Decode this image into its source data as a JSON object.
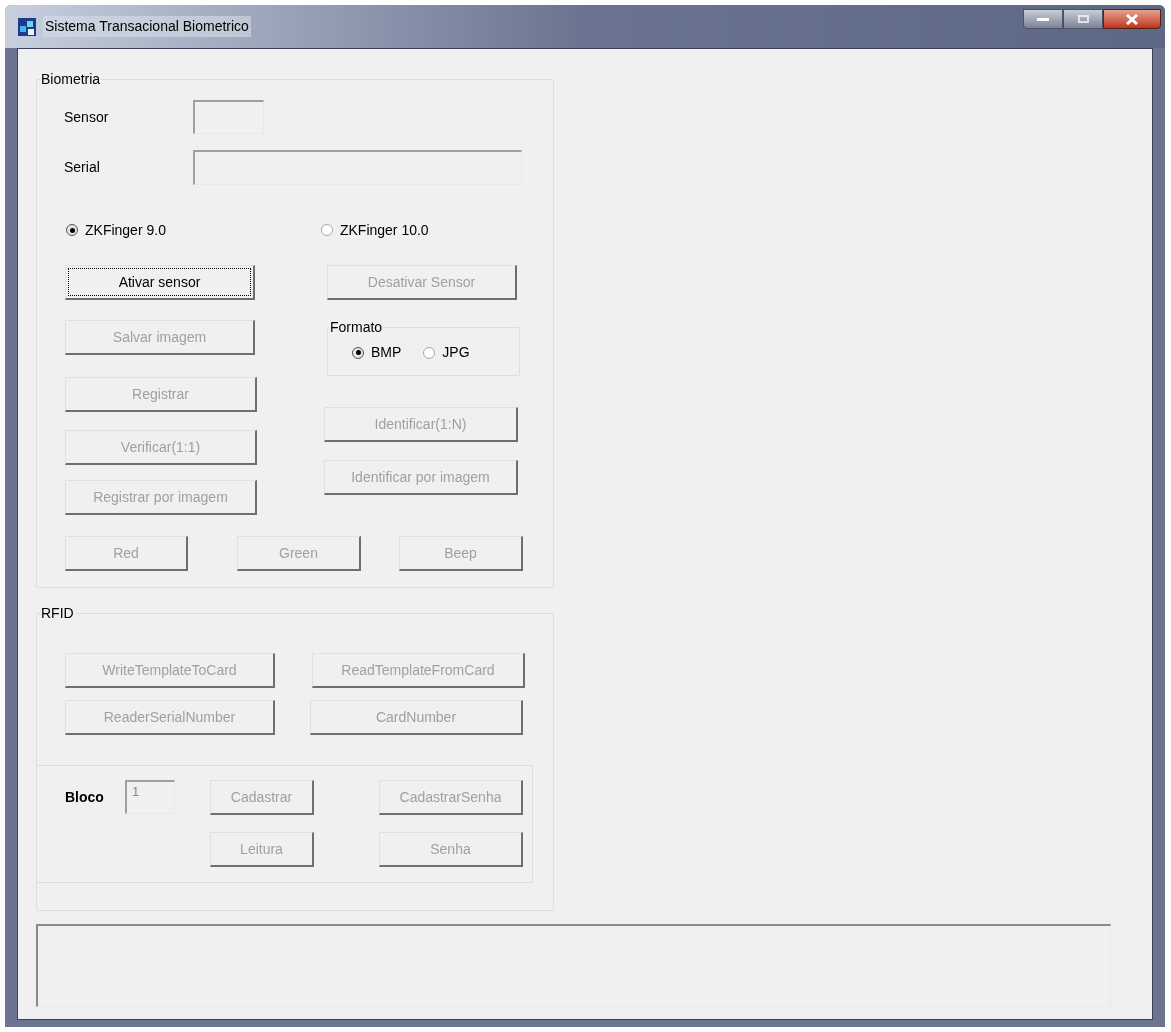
{
  "window": {
    "title": "Sistema Transacional Biometrico"
  },
  "biometria": {
    "title": "Biometria",
    "sensor": {
      "label": "Sensor"
    },
    "serial": {
      "label": "Serial"
    },
    "sdk_options": [
      {
        "label": "ZKFinger 9.0",
        "selected": true
      },
      {
        "label": "ZKFinger 10.0",
        "selected": false
      }
    ],
    "left_buttons": [
      {
        "label": "Ativar sensor",
        "disabled": false,
        "focused": true
      },
      {
        "label": "Salvar imagem",
        "disabled": true,
        "focused": false
      },
      {
        "label": "Registrar",
        "disabled": true,
        "focused": false
      },
      {
        "label": "Verificar(1:1)",
        "disabled": true,
        "focused": false
      },
      {
        "label": "Registrar por imagem",
        "disabled": true,
        "focused": false
      }
    ],
    "deactivate_button": {
      "label": "Desativar Sensor",
      "disabled": true,
      "focused": false
    },
    "formato": {
      "title": "Formato",
      "options": [
        {
          "label": "BMP",
          "selected": true
        },
        {
          "label": "JPG",
          "selected": false
        }
      ]
    },
    "identify_buttons": [
      {
        "label": "Identificar(1:N)",
        "disabled": true,
        "focused": false
      },
      {
        "label": "Identificar por imagem",
        "disabled": true,
        "focused": false
      }
    ],
    "led_buttons": [
      {
        "label": "Red",
        "disabled": true,
        "focused": false
      },
      {
        "label": "Green",
        "disabled": true,
        "focused": false
      },
      {
        "label": "Beep",
        "disabled": true,
        "focused": false
      }
    ]
  },
  "rfid": {
    "title": "RFID",
    "card_buttons": [
      {
        "label": "WriteTemplateToCard",
        "disabled": true,
        "focused": false
      },
      {
        "label": "ReadTemplateFromCard",
        "disabled": true,
        "focused": false
      },
      {
        "label": "ReaderSerialNumber",
        "disabled": true,
        "focused": false
      },
      {
        "label": "CardNumber",
        "disabled": true,
        "focused": false
      }
    ],
    "bloco": {
      "label": "Bloco",
      "value": "1",
      "disabled": true
    },
    "block_buttons": [
      {
        "label": "Cadastrar",
        "disabled": true,
        "focused": false
      },
      {
        "label": "CadastrarSenha",
        "disabled": true,
        "focused": false
      },
      {
        "label": "Leitura",
        "disabled": true,
        "focused": false
      },
      {
        "label": "Senha",
        "disabled": true,
        "focused": false
      }
    ]
  }
}
